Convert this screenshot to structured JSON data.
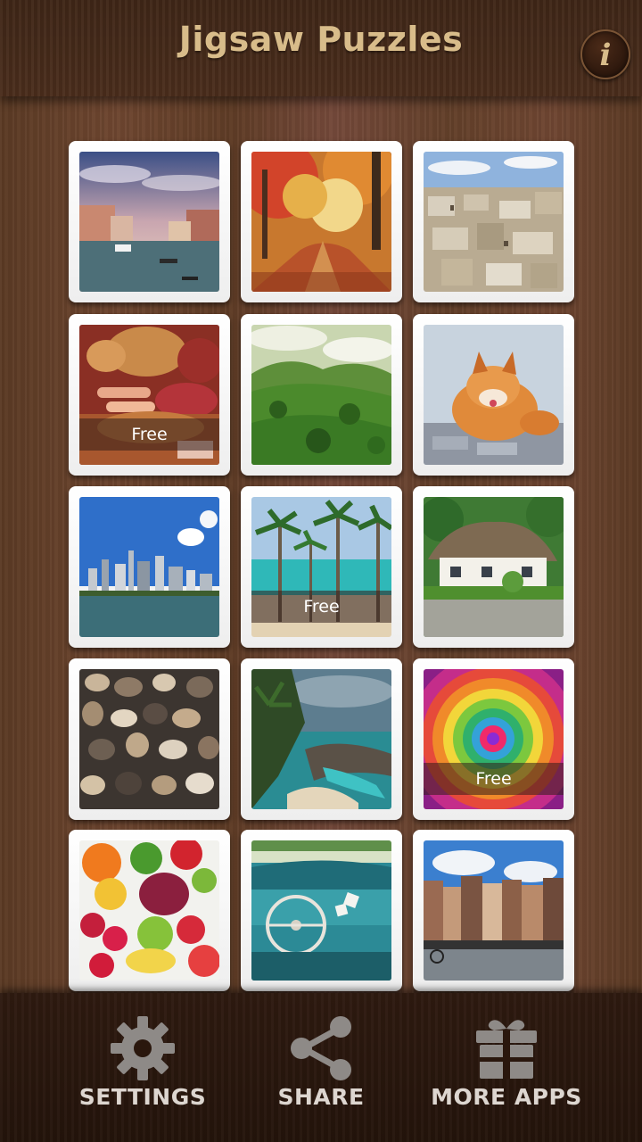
{
  "header": {
    "title": "Jigsaw Puzzles",
    "info_label": "i"
  },
  "puzzles": [
    {
      "name": "venice-canal",
      "free": false
    },
    {
      "name": "autumn-forest",
      "free": false
    },
    {
      "name": "old-city-rooftops",
      "free": false
    },
    {
      "name": "sausages-and-meats",
      "free": true,
      "badge": "Free"
    },
    {
      "name": "green-valley",
      "free": false
    },
    {
      "name": "red-fox",
      "free": false
    },
    {
      "name": "city-skyline",
      "free": false
    },
    {
      "name": "palm-beach",
      "free": true,
      "badge": "Free"
    },
    {
      "name": "thatched-cottage",
      "free": false
    },
    {
      "name": "river-pebbles",
      "free": false
    },
    {
      "name": "coastal-waterfall",
      "free": false
    },
    {
      "name": "colorful-rings",
      "free": true,
      "badge": "Free"
    },
    {
      "name": "fruits-and-vegetables",
      "free": false
    },
    {
      "name": "vintage-car-interior",
      "free": false
    },
    {
      "name": "canal-houses",
      "free": false
    }
  ],
  "bottom_nav": {
    "settings_label": "SETTINGS",
    "share_label": "SHARE",
    "more_apps_label": "MORE APPS"
  },
  "colors": {
    "title": "#d8bc8a",
    "nav_label": "#ddd6d0",
    "nav_icon": "#8e8a87"
  }
}
